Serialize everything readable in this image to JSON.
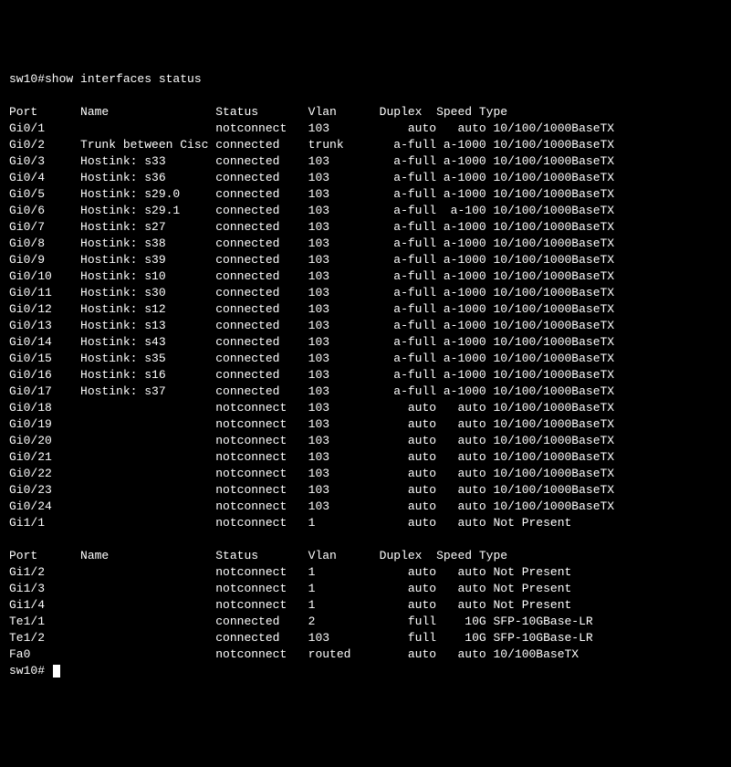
{
  "prompt1": "sw10#show interfaces status",
  "blank": "",
  "headers": {
    "port": "Port",
    "name": "Name",
    "status": "Status",
    "vlan": "Vlan",
    "duplex": "Duplex",
    "speed": "Speed",
    "type": "Type"
  },
  "rows1": [
    {
      "port": "Gi0/1",
      "name": "",
      "status": "notconnect",
      "vlan": "103",
      "duplex": "auto",
      "speed": "auto",
      "type": "10/100/1000BaseTX"
    },
    {
      "port": "Gi0/2",
      "name": "Trunk between Cisc",
      "status": "connected",
      "vlan": "trunk",
      "duplex": "a-full",
      "speed": "a-1000",
      "type": "10/100/1000BaseTX"
    },
    {
      "port": "Gi0/3",
      "name": "Hostink: s33",
      "status": "connected",
      "vlan": "103",
      "duplex": "a-full",
      "speed": "a-1000",
      "type": "10/100/1000BaseTX"
    },
    {
      "port": "Gi0/4",
      "name": "Hostink: s36",
      "status": "connected",
      "vlan": "103",
      "duplex": "a-full",
      "speed": "a-1000",
      "type": "10/100/1000BaseTX"
    },
    {
      "port": "Gi0/5",
      "name": "Hostink: s29.0",
      "status": "connected",
      "vlan": "103",
      "duplex": "a-full",
      "speed": "a-1000",
      "type": "10/100/1000BaseTX"
    },
    {
      "port": "Gi0/6",
      "name": "Hostink: s29.1",
      "status": "connected",
      "vlan": "103",
      "duplex": "a-full",
      "speed": "a-100",
      "type": "10/100/1000BaseTX"
    },
    {
      "port": "Gi0/7",
      "name": "Hostink: s27",
      "status": "connected",
      "vlan": "103",
      "duplex": "a-full",
      "speed": "a-1000",
      "type": "10/100/1000BaseTX"
    },
    {
      "port": "Gi0/8",
      "name": "Hostink: s38",
      "status": "connected",
      "vlan": "103",
      "duplex": "a-full",
      "speed": "a-1000",
      "type": "10/100/1000BaseTX"
    },
    {
      "port": "Gi0/9",
      "name": "Hostink: s39",
      "status": "connected",
      "vlan": "103",
      "duplex": "a-full",
      "speed": "a-1000",
      "type": "10/100/1000BaseTX"
    },
    {
      "port": "Gi0/10",
      "name": "Hostink: s10",
      "status": "connected",
      "vlan": "103",
      "duplex": "a-full",
      "speed": "a-1000",
      "type": "10/100/1000BaseTX"
    },
    {
      "port": "Gi0/11",
      "name": "Hostink: s30",
      "status": "connected",
      "vlan": "103",
      "duplex": "a-full",
      "speed": "a-1000",
      "type": "10/100/1000BaseTX"
    },
    {
      "port": "Gi0/12",
      "name": "Hostink: s12",
      "status": "connected",
      "vlan": "103",
      "duplex": "a-full",
      "speed": "a-1000",
      "type": "10/100/1000BaseTX"
    },
    {
      "port": "Gi0/13",
      "name": "Hostink: s13",
      "status": "connected",
      "vlan": "103",
      "duplex": "a-full",
      "speed": "a-1000",
      "type": "10/100/1000BaseTX"
    },
    {
      "port": "Gi0/14",
      "name": "Hostink: s43",
      "status": "connected",
      "vlan": "103",
      "duplex": "a-full",
      "speed": "a-1000",
      "type": "10/100/1000BaseTX"
    },
    {
      "port": "Gi0/15",
      "name": "Hostink: s35",
      "status": "connected",
      "vlan": "103",
      "duplex": "a-full",
      "speed": "a-1000",
      "type": "10/100/1000BaseTX"
    },
    {
      "port": "Gi0/16",
      "name": "Hostink: s16",
      "status": "connected",
      "vlan": "103",
      "duplex": "a-full",
      "speed": "a-1000",
      "type": "10/100/1000BaseTX"
    },
    {
      "port": "Gi0/17",
      "name": "Hostink: s37",
      "status": "connected",
      "vlan": "103",
      "duplex": "a-full",
      "speed": "a-1000",
      "type": "10/100/1000BaseTX"
    },
    {
      "port": "Gi0/18",
      "name": "",
      "status": "notconnect",
      "vlan": "103",
      "duplex": "auto",
      "speed": "auto",
      "type": "10/100/1000BaseTX"
    },
    {
      "port": "Gi0/19",
      "name": "",
      "status": "notconnect",
      "vlan": "103",
      "duplex": "auto",
      "speed": "auto",
      "type": "10/100/1000BaseTX"
    },
    {
      "port": "Gi0/20",
      "name": "",
      "status": "notconnect",
      "vlan": "103",
      "duplex": "auto",
      "speed": "auto",
      "type": "10/100/1000BaseTX"
    },
    {
      "port": "Gi0/21",
      "name": "",
      "status": "notconnect",
      "vlan": "103",
      "duplex": "auto",
      "speed": "auto",
      "type": "10/100/1000BaseTX"
    },
    {
      "port": "Gi0/22",
      "name": "",
      "status": "notconnect",
      "vlan": "103",
      "duplex": "auto",
      "speed": "auto",
      "type": "10/100/1000BaseTX"
    },
    {
      "port": "Gi0/23",
      "name": "",
      "status": "notconnect",
      "vlan": "103",
      "duplex": "auto",
      "speed": "auto",
      "type": "10/100/1000BaseTX"
    },
    {
      "port": "Gi0/24",
      "name": "",
      "status": "notconnect",
      "vlan": "103",
      "duplex": "auto",
      "speed": "auto",
      "type": "10/100/1000BaseTX"
    },
    {
      "port": "Gi1/1",
      "name": "",
      "status": "notconnect",
      "vlan": "1",
      "duplex": "auto",
      "speed": "auto",
      "type": "Not Present"
    }
  ],
  "rows2": [
    {
      "port": "Gi1/2",
      "name": "",
      "status": "notconnect",
      "vlan": "1",
      "duplex": "auto",
      "speed": "auto",
      "type": "Not Present"
    },
    {
      "port": "Gi1/3",
      "name": "",
      "status": "notconnect",
      "vlan": "1",
      "duplex": "auto",
      "speed": "auto",
      "type": "Not Present"
    },
    {
      "port": "Gi1/4",
      "name": "",
      "status": "notconnect",
      "vlan": "1",
      "duplex": "auto",
      "speed": "auto",
      "type": "Not Present"
    },
    {
      "port": "Te1/1",
      "name": "",
      "status": "connected",
      "vlan": "2",
      "duplex": "full",
      "speed": "10G",
      "type": "SFP-10GBase-LR"
    },
    {
      "port": "Te1/2",
      "name": "",
      "status": "connected",
      "vlan": "103",
      "duplex": "full",
      "speed": "10G",
      "type": "SFP-10GBase-LR"
    },
    {
      "port": "Fa0",
      "name": "",
      "status": "notconnect",
      "vlan": "routed",
      "duplex": "auto",
      "speed": "auto",
      "type": "10/100BaseTX"
    }
  ],
  "prompt2": "sw10# "
}
